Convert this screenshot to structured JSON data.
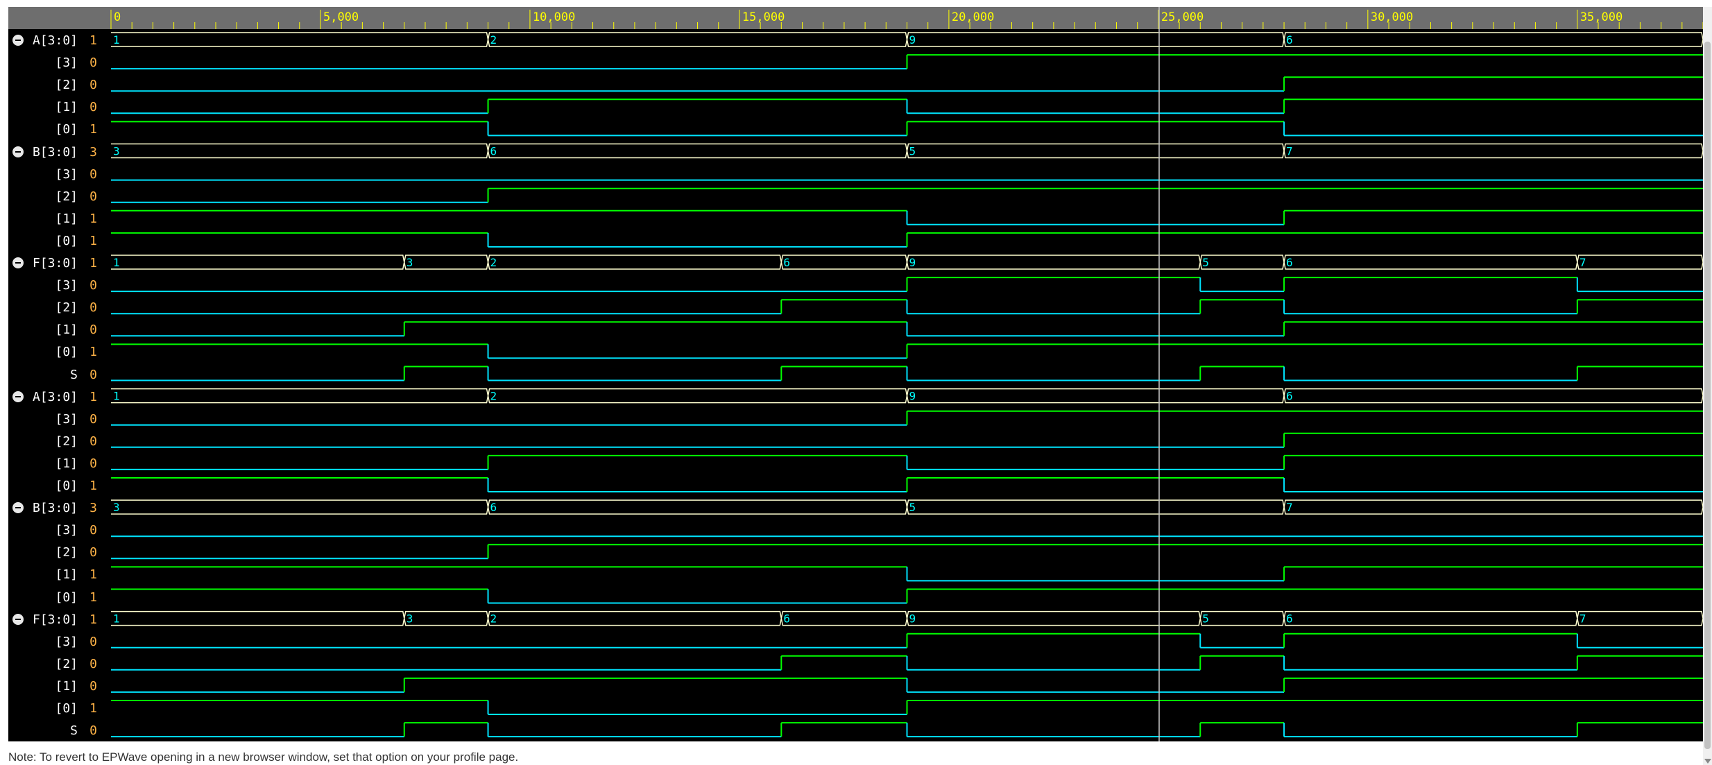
{
  "ruler": {
    "labels": [
      "0",
      "5,000",
      "10,000",
      "15,000",
      "20,000",
      "25,000",
      "30,000",
      "35,000"
    ],
    "label_times": [
      0,
      5000,
      10000,
      15000,
      20000,
      25000,
      30000,
      35000
    ],
    "time_max": 38000,
    "cursor_time": 25000
  },
  "colors": {
    "background": "#000000",
    "ruler_bg": "#6e6e6e",
    "ruler_text": "#ffff00",
    "bus": "#ffffd0",
    "bus_value": "#00ffff",
    "wave_high": "#00ff00",
    "wave_low": "#00e5ff",
    "value_text": "#ffb347",
    "name_text": "#ffffff"
  },
  "signals": [
    {
      "name": "A[3:0]",
      "value": "1",
      "group": true
    },
    {
      "name": "[3]",
      "value": "0"
    },
    {
      "name": "[2]",
      "value": "0"
    },
    {
      "name": "[1]",
      "value": "0"
    },
    {
      "name": "[0]",
      "value": "1"
    },
    {
      "name": "B[3:0]",
      "value": "3",
      "group": true
    },
    {
      "name": "[3]",
      "value": "0"
    },
    {
      "name": "[2]",
      "value": "0"
    },
    {
      "name": "[1]",
      "value": "1"
    },
    {
      "name": "[0]",
      "value": "1"
    },
    {
      "name": "F[3:0]",
      "value": "1",
      "group": true
    },
    {
      "name": "[3]",
      "value": "0"
    },
    {
      "name": "[2]",
      "value": "0"
    },
    {
      "name": "[1]",
      "value": "0"
    },
    {
      "name": "[0]",
      "value": "1"
    },
    {
      "name": "S",
      "value": "0"
    },
    {
      "name": "A[3:0]",
      "value": "1",
      "group": true
    },
    {
      "name": "[3]",
      "value": "0"
    },
    {
      "name": "[2]",
      "value": "0"
    },
    {
      "name": "[1]",
      "value": "0"
    },
    {
      "name": "[0]",
      "value": "1"
    },
    {
      "name": "B[3:0]",
      "value": "3",
      "group": true
    },
    {
      "name": "[3]",
      "value": "0"
    },
    {
      "name": "[2]",
      "value": "0"
    },
    {
      "name": "[1]",
      "value": "1"
    },
    {
      "name": "[0]",
      "value": "1"
    },
    {
      "name": "F[3:0]",
      "value": "1",
      "group": true
    },
    {
      "name": "[3]",
      "value": "0"
    },
    {
      "name": "[2]",
      "value": "0"
    },
    {
      "name": "[1]",
      "value": "0"
    },
    {
      "name": "[0]",
      "value": "1"
    },
    {
      "name": "S",
      "value": "0"
    }
  ],
  "waves": {
    "A_bus": [
      [
        0,
        "1"
      ],
      [
        9000,
        "2"
      ],
      [
        19000,
        "9"
      ],
      [
        28000,
        "6"
      ]
    ],
    "A3": [
      [
        0,
        0
      ],
      [
        19000,
        1
      ]
    ],
    "A2": [
      [
        0,
        0
      ],
      [
        28000,
        1
      ]
    ],
    "A1": [
      [
        0,
        0
      ],
      [
        9000,
        1
      ],
      [
        19000,
        0
      ],
      [
        28000,
        1
      ]
    ],
    "A0": [
      [
        0,
        1
      ],
      [
        9000,
        0
      ],
      [
        19000,
        1
      ],
      [
        28000,
        0
      ]
    ],
    "B_bus": [
      [
        0,
        "3"
      ],
      [
        9000,
        "6"
      ],
      [
        19000,
        "5"
      ],
      [
        28000,
        "7"
      ]
    ],
    "B3": [
      [
        0,
        0
      ]
    ],
    "B2": [
      [
        0,
        0
      ],
      [
        9000,
        1
      ]
    ],
    "B1": [
      [
        0,
        1
      ],
      [
        19000,
        0
      ],
      [
        28000,
        1
      ]
    ],
    "B0": [
      [
        0,
        1
      ],
      [
        9000,
        0
      ],
      [
        19000,
        1
      ]
    ],
    "F_bus": [
      [
        0,
        "1"
      ],
      [
        7000,
        "3"
      ],
      [
        9000,
        "2"
      ],
      [
        16000,
        "6"
      ],
      [
        19000,
        "9"
      ],
      [
        26000,
        "5"
      ],
      [
        28000,
        "6"
      ],
      [
        35000,
        "7"
      ]
    ],
    "F3": [
      [
        0,
        0
      ],
      [
        19000,
        1
      ],
      [
        26000,
        0
      ],
      [
        28000,
        1
      ],
      [
        35000,
        0
      ]
    ],
    "F2": [
      [
        0,
        0
      ],
      [
        16000,
        1
      ],
      [
        19000,
        0
      ],
      [
        26000,
        1
      ],
      [
        28000,
        0
      ],
      [
        35000,
        1
      ]
    ],
    "F1": [
      [
        0,
        0
      ],
      [
        7000,
        1
      ],
      [
        19000,
        0
      ],
      [
        28000,
        1
      ]
    ],
    "F0": [
      [
        0,
        1
      ],
      [
        9000,
        0
      ],
      [
        19000,
        1
      ]
    ],
    "S": [
      [
        0,
        0
      ],
      [
        7000,
        1
      ],
      [
        9000,
        0
      ],
      [
        16000,
        1
      ],
      [
        19000,
        0
      ],
      [
        26000,
        1
      ],
      [
        28000,
        0
      ],
      [
        35000,
        1
      ]
    ]
  },
  "row_waves": [
    "A_bus",
    "A3",
    "A2",
    "A1",
    "A0",
    "B_bus",
    "B3",
    "B2",
    "B1",
    "B0",
    "F_bus",
    "F3",
    "F2",
    "F1",
    "F0",
    "S",
    "A_bus",
    "A3",
    "A2",
    "A1",
    "A0",
    "B_bus",
    "B3",
    "B2",
    "B1",
    "B0",
    "F_bus",
    "F3",
    "F2",
    "F1",
    "F0",
    "S"
  ],
  "footer": {
    "note": "Note: To revert to EPWave opening in a new browser window, set that option on your profile page."
  }
}
